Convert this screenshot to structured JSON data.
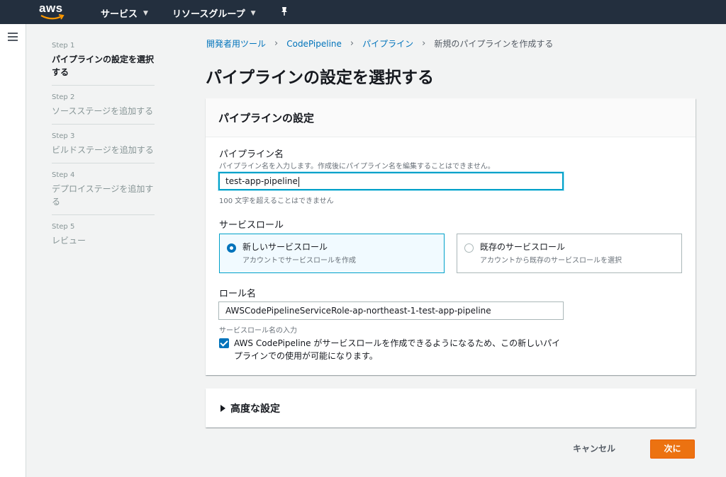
{
  "topnav": {
    "logo": "aws",
    "services_label": "サービス",
    "resource_groups_label": "リソースグループ",
    "pin_icon": "pin-icon"
  },
  "steps": [
    {
      "number": "Step 1",
      "title": "パイプラインの設定を選択する",
      "active": true
    },
    {
      "number": "Step 2",
      "title": "ソースステージを追加する",
      "active": false
    },
    {
      "number": "Step 3",
      "title": "ビルドステージを追加する",
      "active": false
    },
    {
      "number": "Step 4",
      "title": "デプロイステージを追加する",
      "active": false
    },
    {
      "number": "Step 5",
      "title": "レビュー",
      "active": false
    }
  ],
  "breadcrumb": {
    "items": [
      "開発者用ツール",
      "CodePipeline",
      "パイプライン"
    ],
    "current": "新規のパイプラインを作成する"
  },
  "page_title": "パイプラインの設定を選択する",
  "pipeline_settings": {
    "header": "パイプラインの設定",
    "name_label": "パイプライン名",
    "name_desc": "パイプライン名を入力します。作成後にパイプライン名を編集することはできません。",
    "name_value": "test-app-pipeline",
    "name_constraint": "100 文字を超えることはできません",
    "service_role_label": "サービスロール",
    "role_options": [
      {
        "title": "新しいサービスロール",
        "desc": "アカウントでサービスロールを作成",
        "selected": true
      },
      {
        "title": "既存のサービスロール",
        "desc": "アカウントから既存のサービスロールを選択",
        "selected": false
      }
    ],
    "role_name_label": "ロール名",
    "role_name_value": "AWSCodePipelineServiceRole-ap-northeast-1-test-app-pipeline",
    "role_name_desc": "サービスロール名の入力",
    "allow_checkbox_label": "AWS CodePipeline がサービスロールを作成できるようになるため、この新しいパイプラインでの使用が可能になります。",
    "allow_checked": true
  },
  "advanced": {
    "label": "高度な設定"
  },
  "actions": {
    "cancel": "キャンセル",
    "next": "次に"
  },
  "colors": {
    "nav_bg": "#232f3e",
    "link": "#0073bb",
    "primary_button": "#ec7211",
    "focus": "#00a1c9"
  }
}
